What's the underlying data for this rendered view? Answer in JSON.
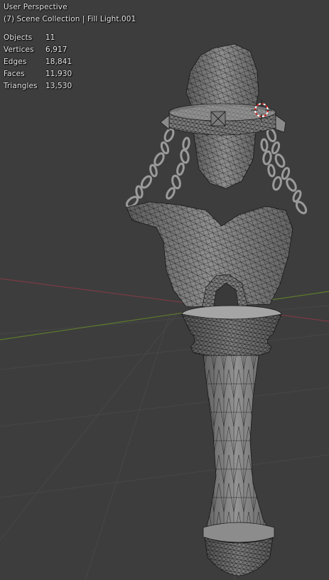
{
  "viewport": {
    "perspective_label": "User Perspective",
    "collection_label": "(7) Scene Collection | Fill Light.001"
  },
  "statistics": [
    {
      "label": "Objects",
      "value": "11"
    },
    {
      "label": "Vertices",
      "value": "6,917"
    },
    {
      "label": "Edges",
      "value": "18,841"
    },
    {
      "label": "Faces",
      "value": "11,930"
    },
    {
      "label": "Triangles",
      "value": "13,530"
    }
  ],
  "colors": {
    "background": "#3d3d3d",
    "grid_line": "#4a4a4a",
    "x_axis": "#7a3a44",
    "y_axis": "#5a7a2a",
    "mesh_fill": "#8f8f8f",
    "wire": "#1a1a1a",
    "cursor_red": "#d82020",
    "cursor_white": "#ffffff"
  },
  "icons": {
    "3d_cursor": "3d-cursor-icon"
  }
}
